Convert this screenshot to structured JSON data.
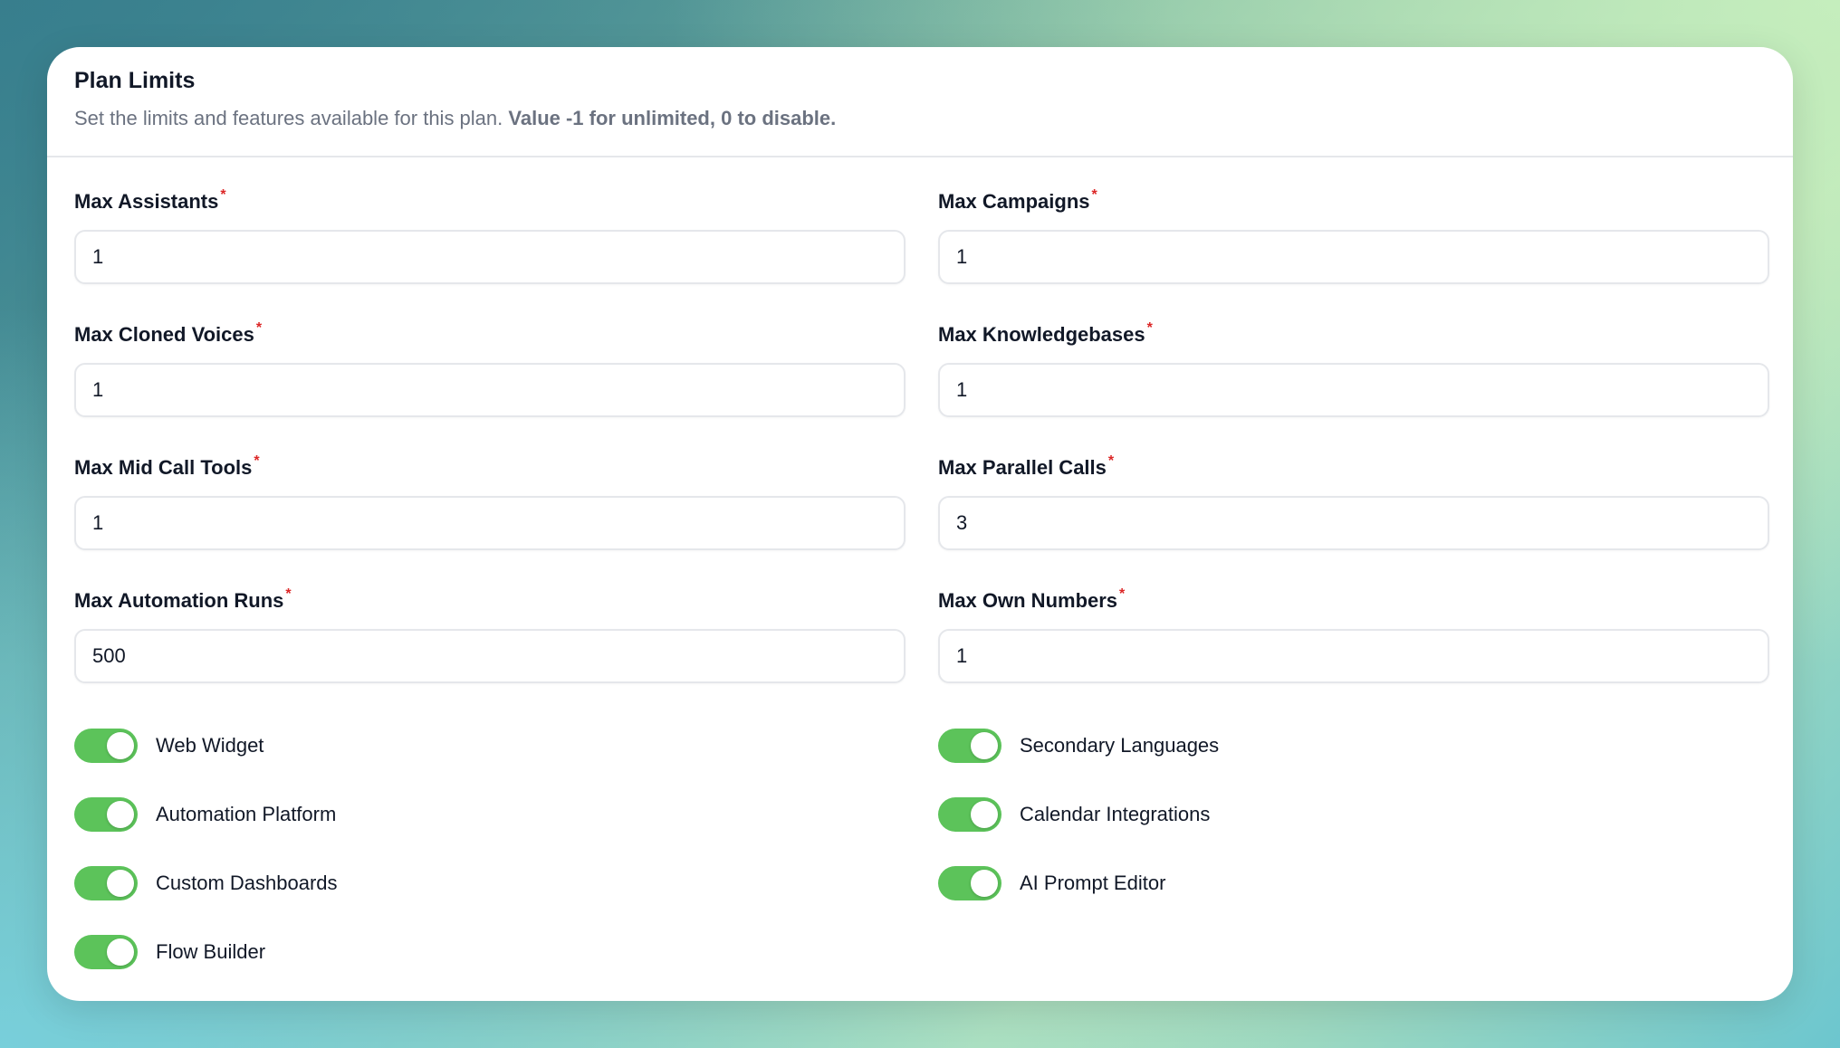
{
  "header": {
    "title": "Plan Limits",
    "description": "Set the limits and features available for this plan.",
    "description_emphasis": "Value -1 for unlimited, 0 to disable."
  },
  "fields": [
    {
      "label": "Max Assistants",
      "value": "1"
    },
    {
      "label": "Max Campaigns",
      "value": "1"
    },
    {
      "label": "Max Cloned Voices",
      "value": "1"
    },
    {
      "label": "Max Knowledgebases",
      "value": "1"
    },
    {
      "label": "Max Mid Call Tools",
      "value": "1"
    },
    {
      "label": "Max Parallel Calls",
      "value": "3"
    },
    {
      "label": "Max Automation Runs",
      "value": "500"
    },
    {
      "label": "Max Own Numbers",
      "value": "1"
    }
  ],
  "required_mark": "*",
  "toggles": [
    {
      "label": "Web Widget",
      "on": true
    },
    {
      "label": "Secondary Languages",
      "on": true
    },
    {
      "label": "Automation Platform",
      "on": true
    },
    {
      "label": "Calendar Integrations",
      "on": true
    },
    {
      "label": "Custom Dashboards",
      "on": true
    },
    {
      "label": "AI Prompt Editor",
      "on": true
    },
    {
      "label": "Flow Builder",
      "on": true
    }
  ],
  "colors": {
    "toggle_on": "#5cc35a",
    "required": "#dc2626"
  }
}
